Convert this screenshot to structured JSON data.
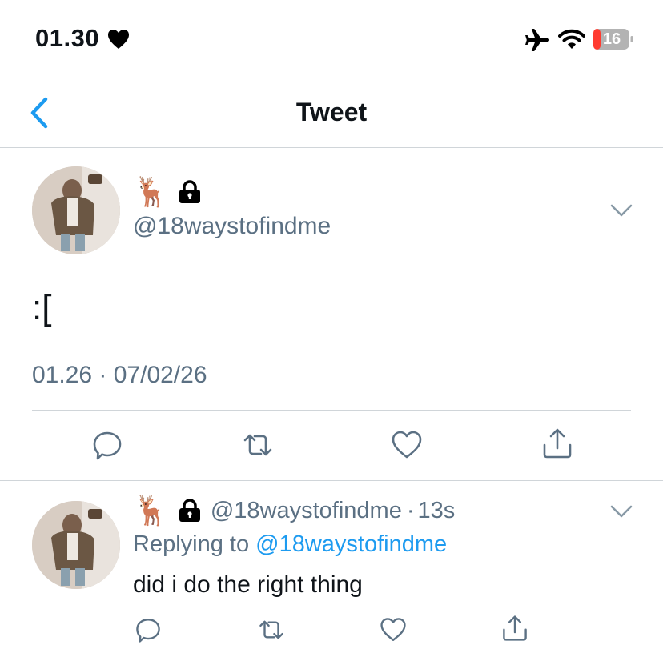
{
  "status_bar": {
    "time": "01.30",
    "battery": "16",
    "icons": [
      "heart-icon",
      "airplane-icon",
      "wifi-icon",
      "battery-charging-icon"
    ]
  },
  "nav": {
    "title": "Tweet",
    "back_icon": "chevron-left-icon"
  },
  "main_tweet": {
    "display_name_emoji": "🦌",
    "handle": "@18waystofindme",
    "text": ":[",
    "timestamp": "01.26 · 07/02/26",
    "actions": [
      "reply-icon",
      "retweet-icon",
      "like-icon",
      "share-icon"
    ]
  },
  "reply": {
    "display_name_emoji": "🦌",
    "handle": "@18waystofindme",
    "separator": "·",
    "time_ago": "13s",
    "replying_to_prefix": "Replying to",
    "replying_to_handle": "@18waystofindme",
    "text": "did i do the right thing"
  },
  "colors": {
    "accent": "#1d9bf0",
    "secondary_text": "#5b7083",
    "divider": "#d0d5d9",
    "battery_low": "#ff3b30"
  }
}
